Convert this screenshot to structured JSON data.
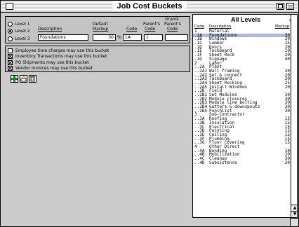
{
  "window": {
    "title": "Job Cost Buckets"
  },
  "editor": {
    "headers": {
      "description": "Description",
      "default_markup_1": "Default",
      "default_markup_2": "Markup",
      "code": "Code",
      "parents_code_1": "Parent's",
      "parents_code_2": "Code",
      "grand_parents_1": "Grand-",
      "grand_parents_2": "Parent's",
      "grand_parents_3": "Code"
    },
    "levels": [
      {
        "label": "Level 1",
        "selected": false
      },
      {
        "label": "Level 2",
        "selected": true
      },
      {
        "label": "Level 3",
        "selected": false
      }
    ],
    "description_value": "Foundations",
    "markup_value": "30",
    "pct_symbol": "%",
    "code_value": "1A",
    "parent_code_value": "1",
    "grand_parent_code_value": ""
  },
  "options": [
    {
      "label": "Employee time charges may use this bucket",
      "checked": false
    },
    {
      "label": "Inventory Transactions may use this bucket",
      "checked": true
    },
    {
      "label": "PO Shipments may use this bucket",
      "checked": true
    },
    {
      "label": "Vendor Invoices may use this bucket",
      "checked": true
    }
  ],
  "toolbar": {
    "add_icon": "plus-icon",
    "edit_icon": "edit-icon",
    "delete_icon": "trash-icon"
  },
  "list": {
    "title": "All Levels",
    "pct_symbol": "%",
    "col_code": "Code",
    "col_description": "Description",
    "col_markup": "Markup",
    "rows": [
      {
        "code": "1",
        "description": "Material",
        "markup": ""
      },
      {
        "code": ".1A",
        "description": "Foundations",
        "markup": "30"
      },
      {
        "code": ".1B",
        "description": "Windows",
        "markup": "20"
      },
      {
        "code": ".1C",
        "description": "Lumber",
        "markup": "25"
      },
      {
        "code": ".1D",
        "description": "Doors",
        "markup": "20"
      },
      {
        "code": ".1E",
        "description": "Tackboard",
        "markup": "10"
      },
      {
        "code": ".1F",
        "description": "Sheet Rock",
        "markup": "20"
      },
      {
        "code": ".1G",
        "description": "Signage",
        "markup": "40"
      },
      {
        "code": "2",
        "description": "Labor",
        "markup": ""
      },
      {
        "code": "..2A",
        "description": "Plant",
        "markup": ""
      },
      {
        "code": "..2A1",
        "description": "Wall framing",
        "markup": "20"
      },
      {
        "code": "..2A2",
        "description": "Set & connect",
        "markup": "20"
      },
      {
        "code": "..2A3",
        "description": "Tackboard",
        "markup": "20"
      },
      {
        "code": "..2A4",
        "description": "Sheet Rocking",
        "markup": "25"
      },
      {
        "code": "..2A5",
        "description": "Install Windows",
        "markup": "20"
      },
      {
        "code": "..2B",
        "description": "Field",
        "markup": ""
      },
      {
        "code": "..2B1",
        "description": "Set Modules",
        "markup": "30"
      },
      {
        "code": "..2B2",
        "description": "Module closures",
        "markup": "30"
      },
      {
        "code": "..2B3",
        "description": "Module line bolting",
        "markup": "30"
      },
      {
        "code": "..2B4",
        "description": "Gutters & downspouts",
        "markup": "30"
      },
      {
        "code": "..2B5",
        "description": "Punchlist",
        "markup": "30"
      },
      {
        "code": "3",
        "description": "Sub-Contractor",
        "markup": ""
      },
      {
        "code": "..3A",
        "description": "Roofing",
        "markup": "15"
      },
      {
        "code": "..3B",
        "description": "Insulation",
        "markup": "15"
      },
      {
        "code": "..3C",
        "description": "Electrical",
        "markup": "15"
      },
      {
        "code": "..3D",
        "description": "Painting",
        "markup": "15"
      },
      {
        "code": "..3E",
        "description": "Ceiling",
        "markup": "15"
      },
      {
        "code": "..3F",
        "description": "Plumbing",
        "markup": "15"
      },
      {
        "code": "..3G",
        "description": "Floor Covering",
        "markup": "15"
      },
      {
        "code": "4",
        "description": "Other Direct",
        "markup": ""
      },
      {
        "code": "..4A",
        "description": "Bonding",
        "markup": "10"
      },
      {
        "code": "..4B",
        "description": "Mobilization",
        "markup": "20"
      },
      {
        "code": "..4C",
        "description": "Cleanup",
        "markup": "30"
      },
      {
        "code": "..4D",
        "description": "Subsistence",
        "markup": "20"
      }
    ],
    "selected_index": 1
  },
  "scroll": {
    "up_arrow": "▲",
    "down_arrow": "▼"
  }
}
